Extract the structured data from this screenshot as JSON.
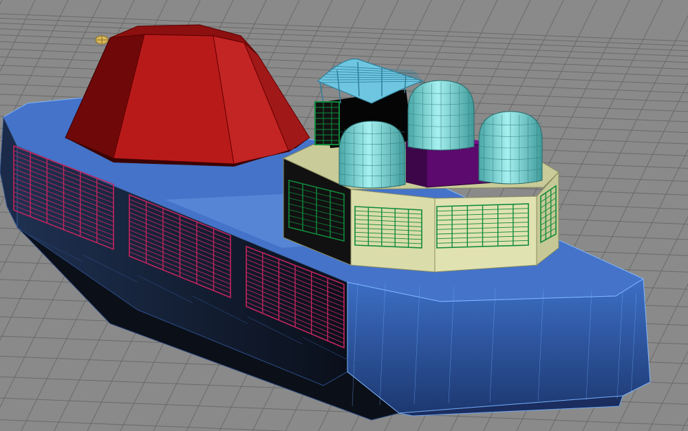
{
  "viewport": {
    "view": "perspective",
    "background_color": "#8a8a8a",
    "grid_color": "#6a6a6a",
    "grid_visible": true
  },
  "model": {
    "hull_color": "#3b6fc4",
    "hull_dark_color": "#0d1424",
    "hull_wire_color": "#6fb0ff",
    "dome_color": "#9c1414",
    "cabin_color": "#d9dca6",
    "capsule_color": "#7fd7d7",
    "box_color": "#6a0a7a",
    "vent_red_color": "#c4245e",
    "vent_green_color": "#0f8a3c",
    "canopy_color": "#5fb7d4",
    "pivot_color": "#c9a34a"
  }
}
